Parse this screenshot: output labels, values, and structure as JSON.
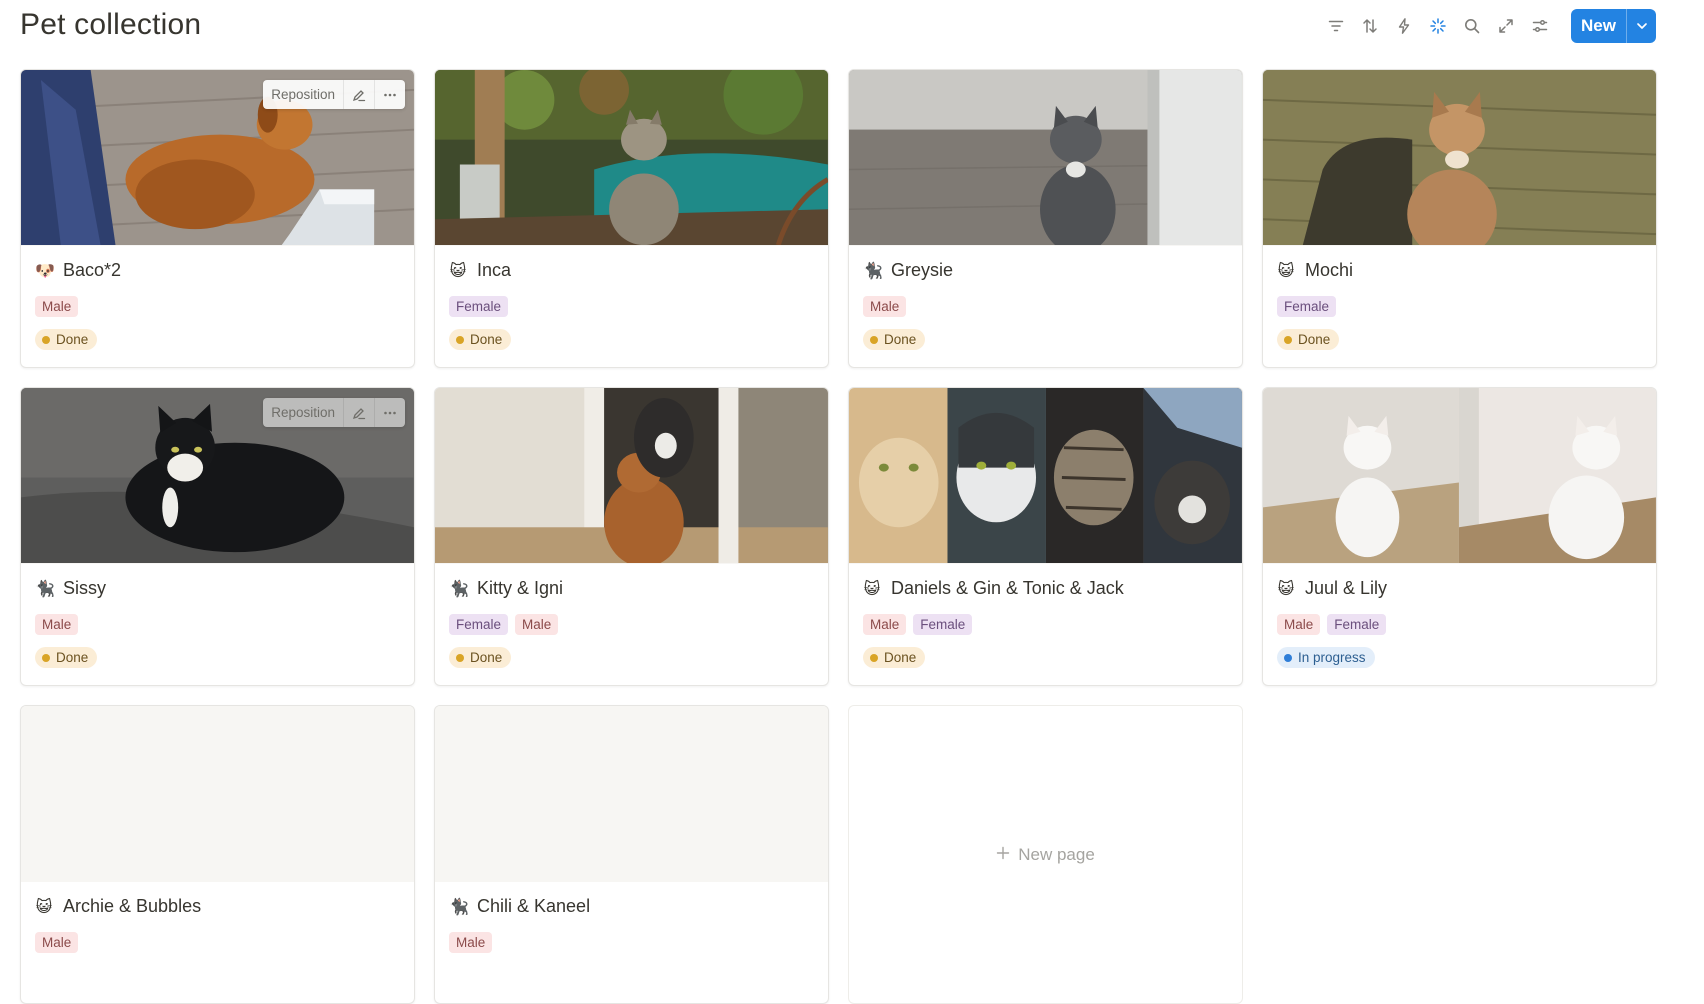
{
  "page": {
    "title": "Pet collection",
    "new_button": "New",
    "accent": "#2383e2"
  },
  "toolbar": {
    "icons": [
      "filter-icon",
      "sort-icon",
      "automation-icon",
      "ai-sparkle-icon",
      "search-icon",
      "expand-icon",
      "settings-icon"
    ]
  },
  "cover_actions": {
    "reposition_label": "Reposition"
  },
  "cards": [
    {
      "name": "Baco*2",
      "emoji": "🐶",
      "genders": [
        "Male"
      ],
      "status": "Done",
      "status_type": "done",
      "cover": "dog-on-deck"
    },
    {
      "name": "Inca",
      "emoji": "😺",
      "genders": [
        "Female"
      ],
      "status": "Done",
      "status_type": "done",
      "cover": "tabby-in-garden"
    },
    {
      "name": "Greysie",
      "emoji": "🐈‍⬛",
      "genders": [
        "Male"
      ],
      "status": "Done",
      "status_type": "done",
      "cover": "grey-cat"
    },
    {
      "name": "Mochi",
      "emoji": "😺",
      "genders": [
        "Female"
      ],
      "status": "Done",
      "status_type": "done",
      "cover": "ginger-tabby-blanket"
    },
    {
      "name": "Sissy",
      "emoji": "🐈‍⬛",
      "genders": [
        "Male"
      ],
      "status": "Done",
      "status_type": "done",
      "cover": "tuxedo-cat"
    },
    {
      "name": "Kitty & Igni",
      "emoji": "🐈‍⬛",
      "genders": [
        "Female",
        "Male"
      ],
      "status": "Done",
      "status_type": "done",
      "cover": "two-cats-doorway"
    },
    {
      "name": "Daniels & Gin & Tonic & Jack",
      "emoji": "😺",
      "genders": [
        "Male",
        "Female"
      ],
      "status": "Done",
      "status_type": "done",
      "cover": "four-cat-collage"
    },
    {
      "name": "Juul & Lily",
      "emoji": "😺",
      "genders": [
        "Male",
        "Female"
      ],
      "status": "In progress",
      "status_type": "progress",
      "cover": "two-white-cats"
    },
    {
      "name": "Archie & Bubbles",
      "emoji": "😺",
      "genders": [
        "Male"
      ],
      "status": "",
      "status_type": "",
      "cover": ""
    },
    {
      "name": "Chili & Kaneel",
      "emoji": "🐈‍⬛",
      "genders": [
        "Male"
      ],
      "status": "",
      "status_type": "",
      "cover": ""
    }
  ],
  "new_page": {
    "label": "New page"
  }
}
